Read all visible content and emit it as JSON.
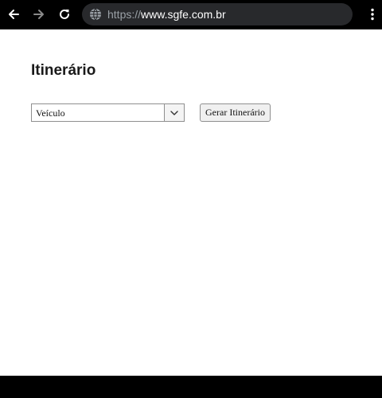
{
  "browser": {
    "url_scheme": "https://",
    "url_host": "www.sgfe.com.br",
    "icons": {
      "back": "arrow-left-icon",
      "forward": "arrow-right-icon",
      "reload": "reload-icon",
      "site_info": "globe-icon",
      "menu": "kebab-menu-icon"
    },
    "colors": {
      "bar": "#000000",
      "omnibox": "#28292c",
      "url_scheme": "#9aa0a6",
      "url_host": "#ffffff"
    }
  },
  "page": {
    "title": "Itinerário",
    "vehicle_select": {
      "selected": "Veículo",
      "arrow_icon": "chevron-down-icon"
    },
    "generate_button_label": "Gerar Itinerário"
  }
}
